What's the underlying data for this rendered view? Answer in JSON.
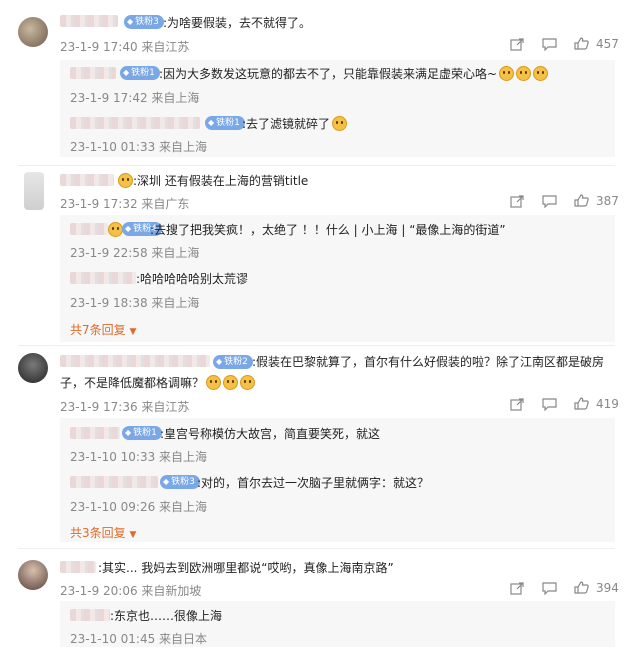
{
  "comments": [
    {
      "text": ":为啥要假装，去不就得了。",
      "badge": "铁粉3",
      "meta": "23-1-9 17:40 来自江苏",
      "likes": "457",
      "replies": [
        {
          "badge": "铁粉1",
          "text": ":因为大多数发这玩意的都去不了，只能靠假装来满足虚荣心咯~",
          "meta": "23-1-9 17:42 来自上海"
        },
        {
          "badge": "铁粉1",
          "text": ":去了滤镜就碎了",
          "meta": "23-1-10 01:33 来自上海"
        }
      ]
    },
    {
      "text": ":深圳 还有假装在上海的营销title",
      "meta": "23-1-9 17:32 来自广东",
      "likes": "387",
      "replies": [
        {
          "badge": "铁粉4",
          "text": ":去搜了把我笑疯！，太绝了 ！！什么 | 小上海 | “最像上海的街道”",
          "meta": "23-1-9 22:58 来自上海"
        },
        {
          "text": ":哈哈哈哈哈别太荒谬",
          "meta": "23-1-9 18:38 来自上海"
        }
      ],
      "more_label": "共7条回复"
    },
    {
      "text_line1": ":假装在巴黎就算了，首尔有什么好假装的啦？除了江南区都是破房",
      "text_line2": "子，不是降低魔都格调嘛？",
      "badge": "铁粉2",
      "meta": "23-1-9 17:36 来自江苏",
      "likes": "419",
      "replies": [
        {
          "badge": "铁粉1",
          "text": ":皇宫号称模仿大故宫，简直要笑死，就这",
          "meta": "23-1-10 10:33 来自上海"
        },
        {
          "badge": "铁粉3",
          "text": ":对的，首尔去过一次脑子里就俩字：就这？",
          "meta": "23-1-10 09:26 来自上海"
        }
      ],
      "more_label": "共3条回复"
    },
    {
      "text": ":其实... 我妈去到欧洲哪里都说“哎哟，真像上海南京路”",
      "meta": "23-1-9 20:06 来自新加坡",
      "likes": "394",
      "replies": [
        {
          "text": ":东京也……很像上海",
          "meta": "23-1-10 01:45 来自日本"
        }
      ]
    }
  ],
  "icons": [
    "share-icon",
    "comment-icon",
    "like-icon",
    "chevron-down-icon"
  ],
  "colors": {
    "meta": "#888888",
    "badge": "#7aa7e6",
    "more": "#e06a2c",
    "reply_bg": "#f7f7f7"
  }
}
